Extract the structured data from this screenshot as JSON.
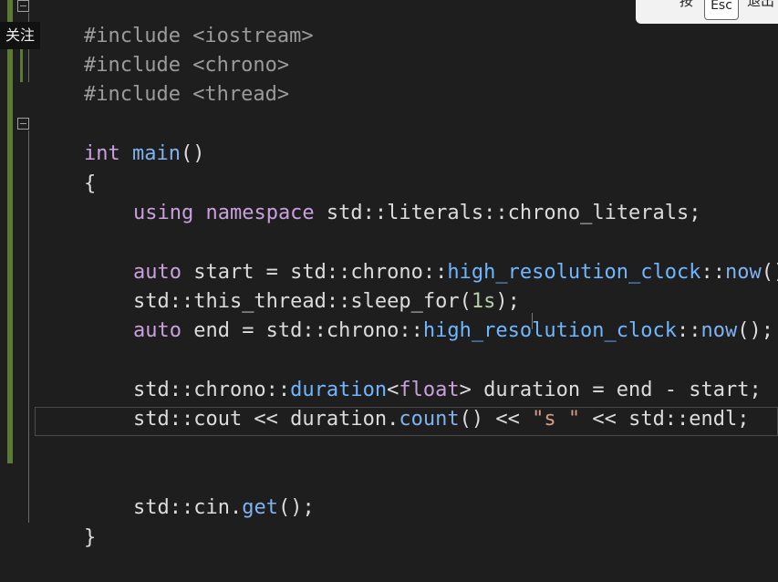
{
  "overlay": {
    "follow_label": "关注",
    "hint_press": "按",
    "hint_key": "Esc",
    "hint_exit": "退出"
  },
  "code": {
    "l1": "#include <iostream>",
    "l2": "#include <chrono>",
    "l3": "#include <thread>",
    "main_kw": "int",
    "main_fn": "main",
    "main_rest": "()",
    "open_brace": "{",
    "using_kw": "using",
    "ns_kw": "namespace",
    "using_rest": " std::literals::chrono_literals;",
    "auto_kw": "auto",
    "start_mid": " start = std::chrono::",
    "hrc": "high_resolution_clock",
    "sep": "::",
    "now": "now",
    "call_end": "();",
    "sleep_a": "std::this_thread::sleep_for(",
    "sleep_num": "1s",
    "sleep_b": ");",
    "end_mid": " end = std::chrono::",
    "dur_a": "std::chrono::",
    "dur_ty": "duration",
    "lt": "<",
    "float_kw": "float",
    "dur_b": "> duration = end - start;",
    "cout_a": "std::cout << duration.",
    "count": "count",
    "cout_b": "() << ",
    "cout_str": "\"s \"",
    "cout_c": " << std::endl;",
    "cin_a": "std::cin.",
    "get": "get",
    "cin_b": "();",
    "close_brace": "}"
  }
}
